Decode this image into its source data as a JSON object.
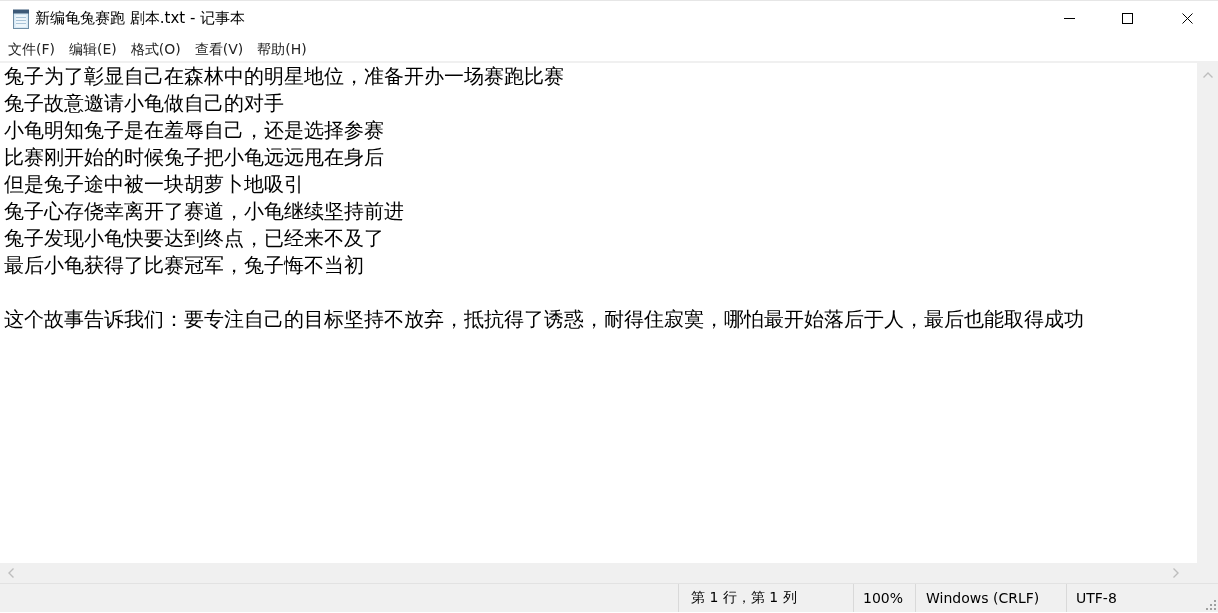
{
  "window": {
    "title": "新编龟兔赛跑 剧本.txt - 记事本"
  },
  "menu": [
    "文件(F)",
    "编辑(E)",
    "格式(O)",
    "查看(V)",
    "帮助(H)"
  ],
  "editor": {
    "paragraphs": [
      {
        "lines": [
          "兔子为了彰显自己在森林中的明星地位，准备开办一场赛跑比赛",
          "兔子故意邀请小龟做自己的对手",
          "小龟明知兔子是在羞辱自己，还是选择参赛",
          "比赛刚开始的时候兔子把小龟远远甩在身后",
          "但是兔子途中被一块胡萝卜地吸引",
          "兔子心存侥幸离开了赛道，小龟继续坚持前进",
          "兔子发现小龟快要达到终点，已经来不及了",
          "最后小龟获得了比赛冠军，兔子悔不当初"
        ]
      },
      {
        "lines": [
          "这个故事告诉我们：要专注自己的目标坚持不放弃，抵抗得了诱惑，耐得住寂寞，哪怕最开始落后于人，最后也能取得成功"
        ]
      }
    ]
  },
  "status_bar": {
    "position": "第 1 行，第 1 列",
    "zoom": "100%",
    "line_ending": "Windows (CRLF)",
    "encoding": "UTF-8"
  }
}
